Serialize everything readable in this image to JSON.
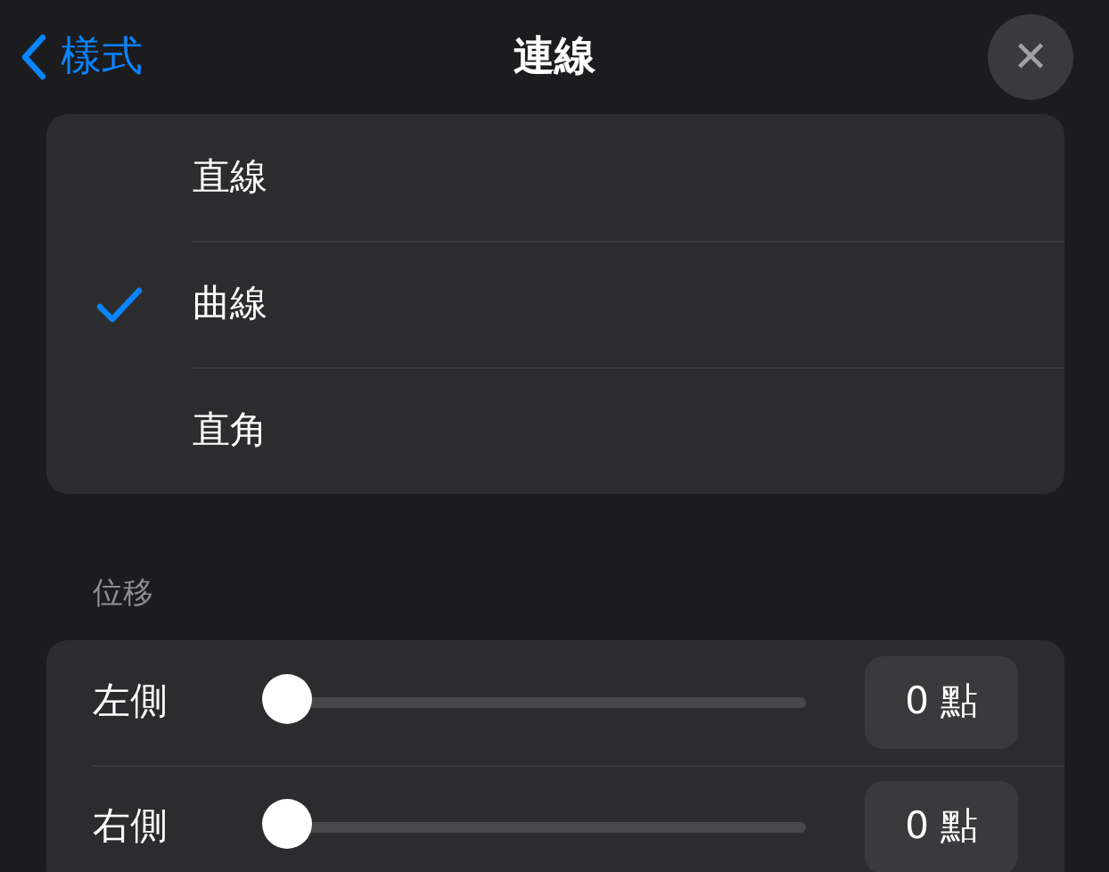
{
  "header": {
    "back": {
      "label": "樣式"
    },
    "title": "連線",
    "close": {
      "label": "✕"
    }
  },
  "line_types": [
    {
      "label": "直線",
      "selected": false
    },
    {
      "label": "曲線",
      "selected": true
    },
    {
      "label": "直角",
      "selected": false
    }
  ],
  "offset": {
    "heading": "位移",
    "rows": [
      {
        "label": "左側",
        "level": 0,
        "value": "0 點"
      },
      {
        "label": "右側",
        "level": 0,
        "value": "0 點"
      }
    ]
  }
}
